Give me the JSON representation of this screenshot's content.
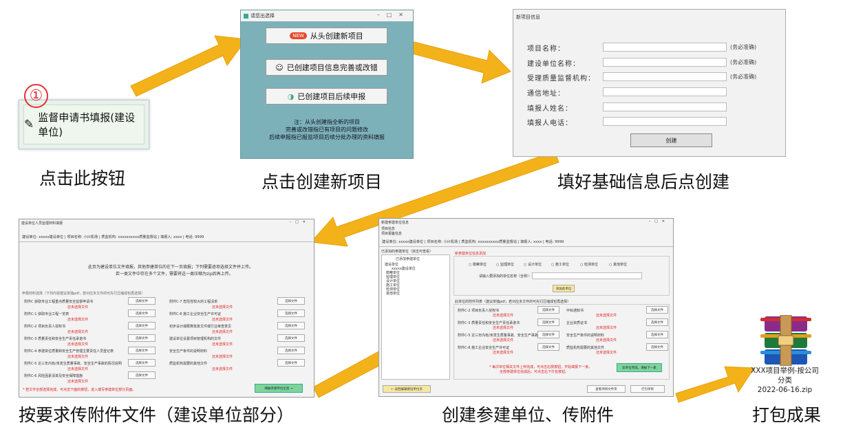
{
  "colors": {
    "arrow": "#f3b21a",
    "teal": "#7db1b9",
    "red": "#e02020",
    "green": "#7fd49a"
  },
  "step1": {
    "badge": "①",
    "button_label": "监督申请书填报(建设单位)",
    "caption": "点击此按钮"
  },
  "step2": {
    "window_title": "请您出选择",
    "new_tag": "NEW",
    "btn_new": "从头创建新项目",
    "btn_edit": "已创建项目信息完善或改错",
    "btn_followup": "已创建项目后续申报",
    "note_lines": [
      "注：从头创建指全新的项目",
      "完善或改错指已有项目的问题修改",
      "后续申报指已报监项目后续分批办理的资料填报"
    ],
    "caption": "点击创建新项目"
  },
  "step3": {
    "header": "新项目信息",
    "fields": [
      {
        "label": "项目名称：",
        "hint": "(务必准确)"
      },
      {
        "label": "建设单位名称：",
        "hint": "(务必准确)"
      },
      {
        "label": "受理质量监督机构：",
        "hint": "(务必准确)"
      },
      {
        "label": "通信地址：",
        "hint": ""
      },
      {
        "label": "填报人姓名：",
        "hint": ""
      },
      {
        "label": "填报人电话：",
        "hint": ""
      }
    ],
    "create_button": "创建",
    "caption": "填好基础信息后点创建"
  },
  "step4": {
    "window_title": "建设单位人员监理材料填报",
    "info_bar": "建设单位: xxxxx建设单位  |  项目名称: 小兴机场  |  质监机构: xxxxxxxxxx质量监督站  |  填报人: xxxx  |  电话: 9999",
    "intro1": "此页为建设单位文件填报，其他参建单位的在下一页填报；下列需要逐项选择文件并上传。",
    "intro2": "若一类文件中存在多个文件，需要将这一类压缩为zip后再上传。",
    "section": "申报材料选择（下列内容建议单独pdf，若对应多文件的可先行压缩成包再选择）",
    "left_items": [
      "附件C 获取专业工程重点质量安全监督申请书",
      "附件C-1 获取专业工程一览表",
      "附件C-2 项目负责人授权书",
      "附件C-3 质量责任和安全生产责任承诺书",
      "附件C-4 参建单位质量和安全生产管理主要责任人员登记表",
      "附件C-5 近三年内有/未发生质量事故、安全生产事故的情况说明",
      "附件C-6 风险因素清单及安全保障措施"
    ],
    "right_items": [
      "附件C-7 危险性较大的工程清单",
      "附件C-8 施工企业安全生产许可证",
      "初步设计或概算批复文件或行业审查意见",
      "建设单位设置项目管理机构的文件",
      "安全生产条件的说明材料",
      "质监机构需要的其他文件"
    ],
    "choose_file": "选择文件",
    "not_chosen": "还未选择文件",
    "warning": "* 若文件全部选择完成，可点击下面的按钮，进入填写参建单位部分页面。",
    "next_button": "填报参建单位信息 →",
    "caption": "按要求传附件文件（建设单位部分）"
  },
  "step5": {
    "window_title": "新建参建单位信息",
    "menu1": "项目信息",
    "menu2": "项目报备信息",
    "info_bar": "建设单位: xxxxx建设单位  |  项目名称: 小兴机场  |  质监机构: xxxxxxxxxx质量监督站  |  填报人: xxxx  |  电话: 9999",
    "tree_header": "已添加的参建单位（双击可查看）",
    "tree_items": [
      "已添加参建单位",
      "建设单位",
      "xxxxx建设单位",
      "勘察单位",
      "监理单位",
      "设计单位",
      "施工单位",
      "检测单位",
      "其他单位"
    ],
    "add_section": "新参建单位信息添加",
    "radio_options": [
      "勘察单位",
      "监理单位",
      "设计单位",
      "施工单位",
      "检测单位",
      "其他单位"
    ],
    "name_label": "请输入要添加的单位名称（全称）：",
    "add_button": "添加此单位",
    "upload_section": "此单位的附件列表（建议单独pdf，若对应多文件的可先行压缩成包再选择）",
    "left_items": [
      "附件C-2 项目负责人授权书",
      "附件C-3 质量责任和安全生产责任承诺书",
      "附件C-5 近三年内有/未发生质量事故、安全生产事故情况说明",
      "附件C-8 施工企业安全生产许可证"
    ],
    "right_items": [
      "中标通知书",
      "企业资质证书",
      "安全生产条件的说明材料",
      "质监机构需要的其他文件"
    ],
    "choose_file": "选择文件",
    "not_chosen": "还未选择文件",
    "warning_lines": [
      "* 每次单位相关文件上传完成，可点击右侧按钮，开始填报下一家。",
      "全部参建单位完成后，可点击右下打包按钮。"
    ],
    "done_button": "此单位完成，填报下一家",
    "back_button": "← 返回编辑建设单位页",
    "view_button": "查看项目文件夹",
    "pack_button": "打包项目",
    "caption": "创建参建单位、传附件"
  },
  "step6": {
    "file_label": "XXX项目举例-按公司分类",
    "date_label": "2022-06-16.zip",
    "caption": "打包成果"
  }
}
